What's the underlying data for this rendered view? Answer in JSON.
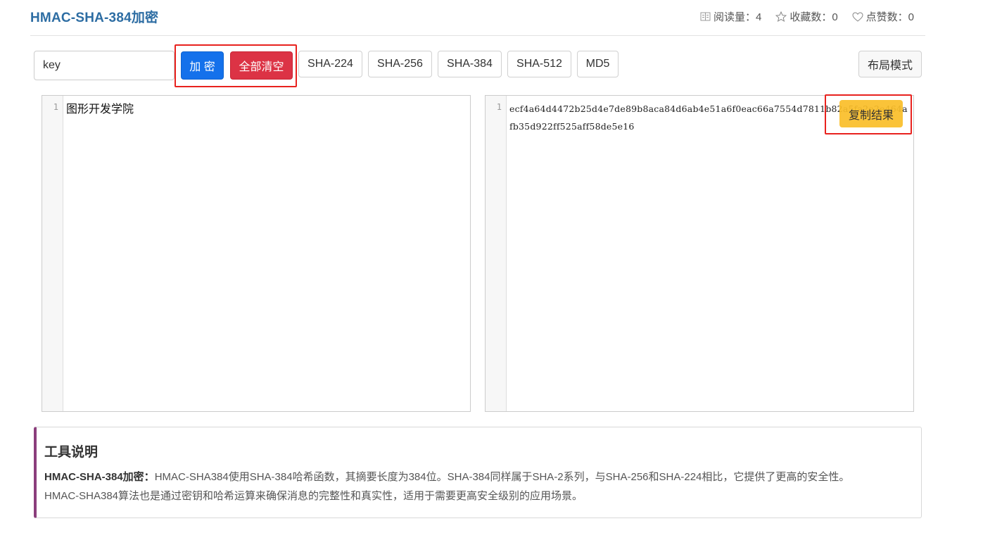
{
  "header": {
    "title": "HMAC-SHA-384加密",
    "stats": [
      {
        "icon": "book-icon",
        "label": "阅读量：4"
      },
      {
        "icon": "star-icon",
        "label": "收藏数：0"
      },
      {
        "icon": "heart-icon",
        "label": "点赞数：0"
      }
    ]
  },
  "toolbar": {
    "key_value": "key",
    "encrypt_label": "加 密",
    "clear_label": "全部清空",
    "algorithms": [
      "SHA-224",
      "SHA-256",
      "SHA-384",
      "SHA-512",
      "MD5"
    ],
    "layout_label": "布局模式"
  },
  "input_editor": {
    "line_number": "1",
    "text": "图形开发学院"
  },
  "output_editor": {
    "line_number": "1",
    "text": "ecf4a64d4472b25d4e7de89b8aca84d6ab4e51a6f0eac66a7554d7811b82a5fa2e2e464afb35d922ff525aff58de5e16",
    "copy_label": "复制结果"
  },
  "description": {
    "title": "工具说明",
    "lead": "HMAC-SHA-384加密：",
    "line1": "HMAC-SHA384使用SHA-384哈希函数，其摘要长度为384位。SHA-384同样属于SHA-2系列，与SHA-256和SHA-224相比，它提供了更高的安全性。",
    "line2": "HMAC-SHA384算法也是通过密钥和哈希运算来确保消息的完整性和真实性，适用于需要更高安全级别的应用场景。"
  },
  "colors": {
    "title": "#2d6da3",
    "encrypt_button": "#1471eb",
    "clear_button": "#dc3345",
    "copy_button": "#fabe28",
    "highlight_box": "#e8221e",
    "desc_accent": "#8b3e7c"
  }
}
